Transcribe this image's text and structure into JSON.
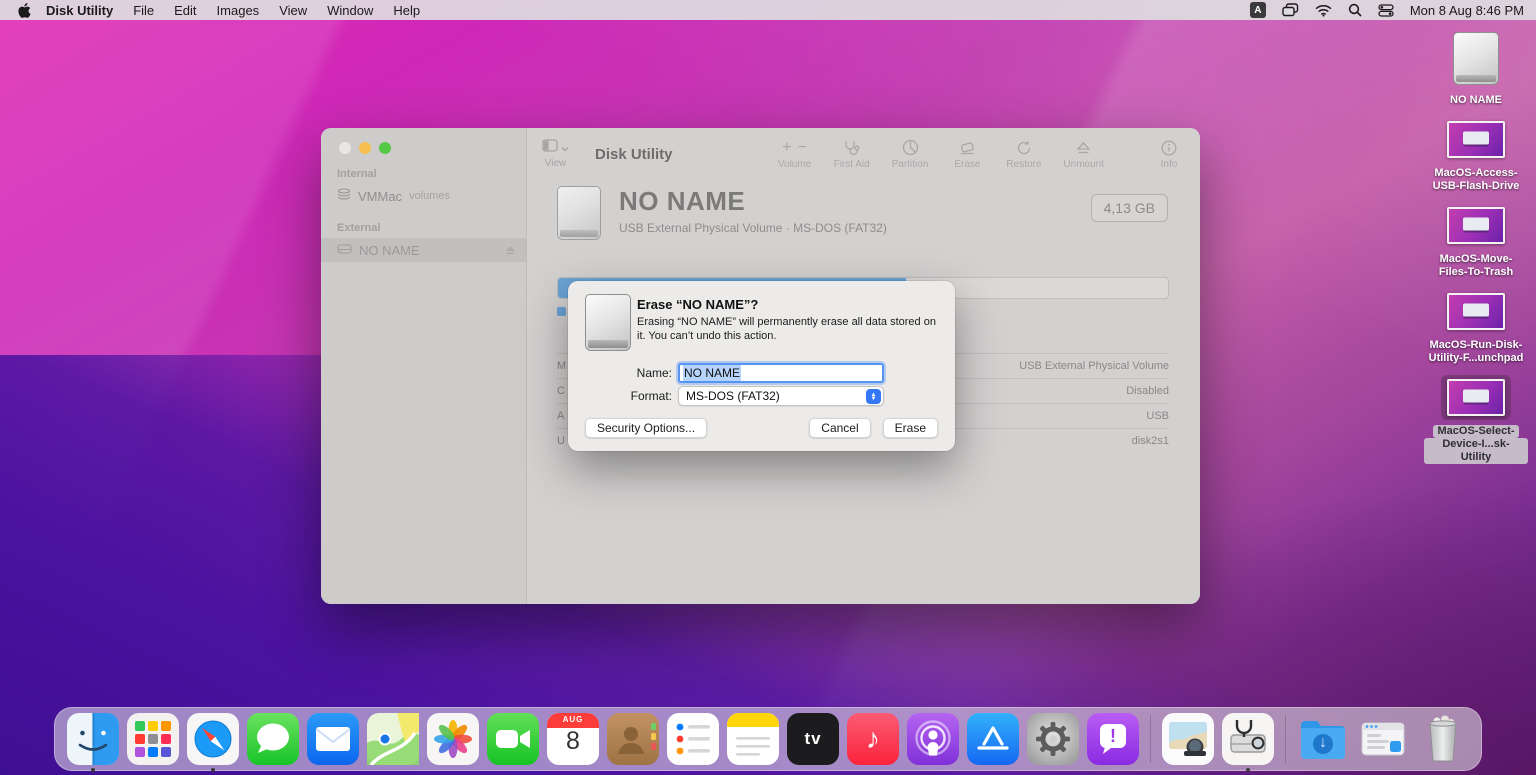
{
  "menu_bar": {
    "app_menu": "Disk Utility",
    "items": [
      "File",
      "Edit",
      "Images",
      "View",
      "Window",
      "Help"
    ],
    "status": {
      "input_badge": "A",
      "clock": "Mon 8 Aug  8:46 PM"
    }
  },
  "window": {
    "toolbar": {
      "view_label": "View",
      "title": "Disk Utility",
      "buttons": [
        {
          "id": "volume",
          "label": "Volume"
        },
        {
          "id": "firstaid",
          "label": "First Aid"
        },
        {
          "id": "partition",
          "label": "Partition"
        },
        {
          "id": "erase",
          "label": "Erase"
        },
        {
          "id": "restore",
          "label": "Restore"
        },
        {
          "id": "unmount",
          "label": "Unmount"
        },
        {
          "id": "info",
          "label": "Info"
        }
      ]
    },
    "sidebar": {
      "sections": [
        {
          "header": "Internal",
          "items": [
            {
              "label": "VMMac",
              "suffix": "volumes",
              "icon": "layers-icon",
              "selected": false,
              "eject": false
            }
          ]
        },
        {
          "header": "External",
          "items": [
            {
              "label": "NO NAME",
              "suffix": "",
              "icon": "drive-icon",
              "selected": true,
              "eject": true
            }
          ]
        }
      ]
    },
    "content": {
      "volume_name": "NO NAME",
      "volume_desc": "USB External Physical Volume · MS-DOS (FAT32)",
      "size_badge": "4,13 GB",
      "capacity_fill_pct": 57,
      "info_rows": [
        {
          "label": "M",
          "value": "USB External Physical Volume"
        },
        {
          "label": "C",
          "value": "Disabled"
        },
        {
          "label": "A",
          "value": "USB"
        },
        {
          "label": "U",
          "value": "disk2s1"
        }
      ]
    }
  },
  "dialog": {
    "title": "Erase “NO NAME”?",
    "message": "Erasing “NO NAME” will permanently erase all data stored on it. You can’t undo this action.",
    "name_label": "Name:",
    "name_value": "NO NAME",
    "format_label": "Format:",
    "format_value": "MS-DOS (FAT32)",
    "security_button": "Security Options...",
    "cancel_button": "Cancel",
    "erase_button": "Erase"
  },
  "desktop": {
    "icons": [
      {
        "type": "disk",
        "lines": [
          "NO NAME"
        ],
        "selected": false
      },
      {
        "type": "shot",
        "lines": [
          "MacOS-Access-",
          "USB-Flash-Drive"
        ],
        "selected": false
      },
      {
        "type": "shot",
        "lines": [
          "MacOS-Move-",
          "Files-To-Trash"
        ],
        "selected": false
      },
      {
        "type": "shot",
        "lines": [
          "MacOS-Run-Disk-",
          "Utility-F...unchpad"
        ],
        "selected": false
      },
      {
        "type": "shot",
        "lines": [
          "MacOS-Select-",
          "Device-I...sk-Utility"
        ],
        "selected": true
      }
    ]
  },
  "dock": {
    "items": [
      {
        "id": "finder",
        "label": "Finder",
        "running": true
      },
      {
        "id": "launchpad",
        "label": "Launchpad",
        "running": false
      },
      {
        "id": "safari",
        "label": "Safari",
        "running": true
      },
      {
        "id": "messages",
        "label": "Messages",
        "running": false
      },
      {
        "id": "mail",
        "label": "Mail",
        "running": false
      },
      {
        "id": "maps",
        "label": "Maps",
        "running": false
      },
      {
        "id": "photos",
        "label": "Photos",
        "running": false
      },
      {
        "id": "facetime",
        "label": "FaceTime",
        "running": false
      },
      {
        "id": "calendar",
        "label": "Calendar",
        "running": false,
        "month": "AUG",
        "day": "8"
      },
      {
        "id": "contacts",
        "label": "Contacts",
        "running": false
      },
      {
        "id": "reminders",
        "label": "Reminders",
        "running": false
      },
      {
        "id": "notes",
        "label": "Notes",
        "running": false
      },
      {
        "id": "tv",
        "label": "TV",
        "running": false,
        "glyph": "tv"
      },
      {
        "id": "music",
        "label": "Music",
        "running": false,
        "glyph": "♪"
      },
      {
        "id": "podcasts",
        "label": "Podcasts",
        "running": false
      },
      {
        "id": "appstore",
        "label": "App Store",
        "running": false,
        "glyph": "A"
      },
      {
        "id": "settings",
        "label": "System Preferences",
        "running": false
      },
      {
        "id": "feedback",
        "label": "Feedback Assistant",
        "running": false,
        "glyph": "!"
      },
      {
        "id": "separator"
      },
      {
        "id": "preview",
        "label": "Preview",
        "running": false
      },
      {
        "id": "diskutility",
        "label": "Disk Utility",
        "running": true
      },
      {
        "id": "separator"
      },
      {
        "id": "downloads",
        "label": "Downloads",
        "running": false,
        "glyph": "↓"
      },
      {
        "id": "minwindow",
        "label": "Minimized Window",
        "running": false
      },
      {
        "id": "trash",
        "label": "Trash",
        "running": false
      }
    ]
  },
  "colors": {
    "accent_blue": "#3478f6",
    "capacity_blue": "#6ba3d6",
    "traffic_close": "#e9e7e5",
    "traffic_min": "#f5bf4f",
    "traffic_max": "#55c944"
  }
}
